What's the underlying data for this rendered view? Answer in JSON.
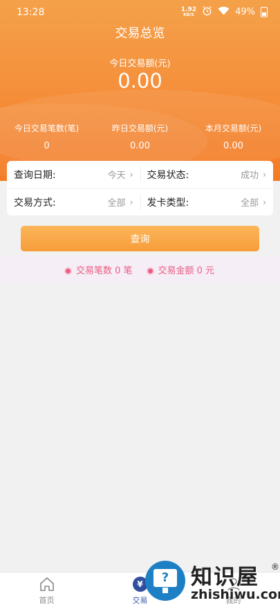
{
  "status_bar": {
    "time": "13:28",
    "net_speed": "1.92",
    "net_unit": "KB/S",
    "battery": "49%"
  },
  "header": {
    "title": "交易总览"
  },
  "today": {
    "label": "今日交易额(元)",
    "value": "0.00"
  },
  "stats": [
    {
      "label": "今日交易笔数(笔)",
      "value": "0"
    },
    {
      "label": "昨日交易额(元)",
      "value": "0.00"
    },
    {
      "label": "本月交易额(元)",
      "value": "0.00"
    }
  ],
  "filters": {
    "date": {
      "label": "查询日期:",
      "value": "今天"
    },
    "status": {
      "label": "交易状态:",
      "value": "成功"
    },
    "method": {
      "label": "交易方式:",
      "value": "全部"
    },
    "card_type": {
      "label": "发卡类型:",
      "value": "全部"
    }
  },
  "query_button": "查询",
  "summary": {
    "count_text": "交易笔数 0 笔",
    "amount_text": "交易金额 0 元"
  },
  "tabbar": [
    {
      "label": "首页",
      "icon": "home-icon"
    },
    {
      "label": "交易",
      "icon": "yuan-coin-icon"
    },
    {
      "label": "我的",
      "icon": "user-icon"
    }
  ],
  "watermark": {
    "title": "知识屋",
    "reg": "®",
    "url": "zhishiwu.com"
  },
  "colors": {
    "accent": "#f5913d",
    "summary_pink": "#ea5d82",
    "tab_active": "#3b5bb0"
  }
}
